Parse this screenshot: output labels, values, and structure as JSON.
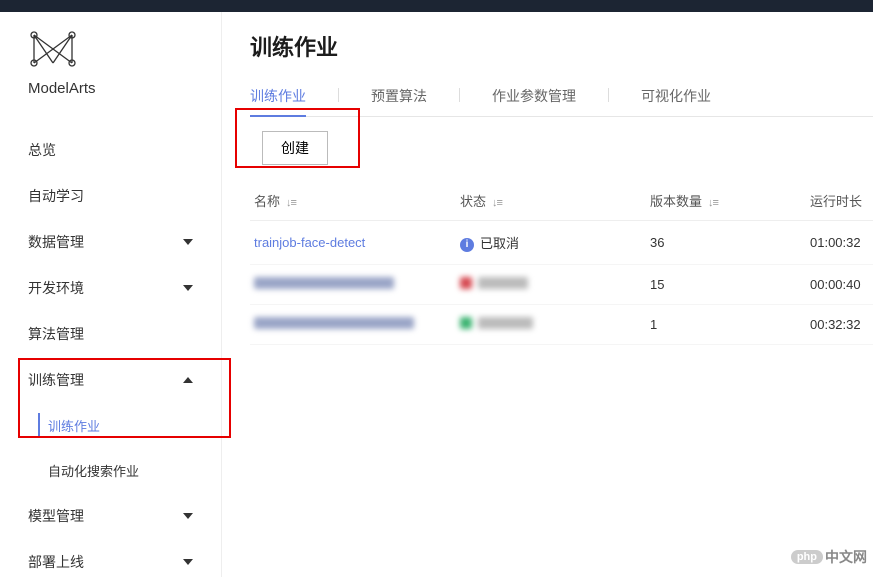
{
  "brand": "ModelArts",
  "sidebar": {
    "items": [
      {
        "label": "总览",
        "expandable": false
      },
      {
        "label": "自动学习",
        "expandable": false
      },
      {
        "label": "数据管理",
        "expandable": true,
        "open": false
      },
      {
        "label": "开发环境",
        "expandable": true,
        "open": false
      },
      {
        "label": "算法管理",
        "expandable": false
      },
      {
        "label": "训练管理",
        "expandable": true,
        "open": true,
        "children": [
          {
            "label": "训练作业",
            "active": true
          },
          {
            "label": "自动化搜索作业",
            "active": false
          }
        ]
      },
      {
        "label": "模型管理",
        "expandable": true,
        "open": false
      },
      {
        "label": "部署上线",
        "expandable": true,
        "open": false
      }
    ]
  },
  "page": {
    "title": "训练作业"
  },
  "tabs": [
    {
      "label": "训练作业",
      "active": true
    },
    {
      "label": "预置算法",
      "active": false
    },
    {
      "label": "作业参数管理",
      "active": false
    },
    {
      "label": "可视化作业",
      "active": false
    }
  ],
  "toolbar": {
    "create_label": "创建"
  },
  "table": {
    "columns": {
      "name": "名称",
      "status": "状态",
      "versions": "版本数量",
      "duration": "运行时长"
    },
    "rows": [
      {
        "name": "trainjob-face-detect",
        "status": "已取消",
        "status_color": "#5e7ce0",
        "versions": "36",
        "duration": "01:00:32",
        "blurred": false
      },
      {
        "name": "",
        "status": "",
        "status_color": "#d64a52",
        "versions": "15",
        "duration": "00:00:40",
        "blurred": true
      },
      {
        "name": "",
        "status": "",
        "status_color": "#3cb371",
        "versions": "1",
        "duration": "00:32:32",
        "blurred": true
      }
    ]
  },
  "watermark": {
    "badge": "php",
    "text": "中文网"
  }
}
